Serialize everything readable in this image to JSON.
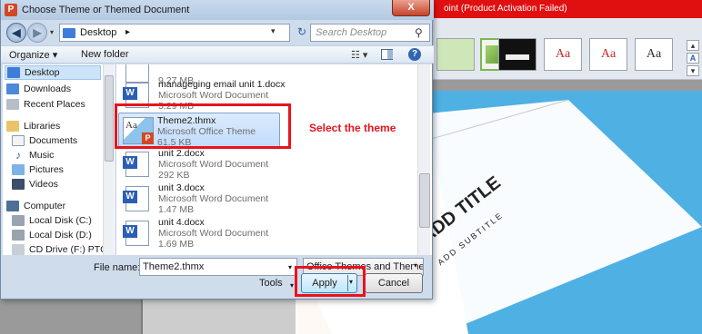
{
  "powerpoint": {
    "title_fragment": "oint (Product Activation Failed)",
    "theme_thumbs": [
      "Aa",
      "Aa",
      "Aa",
      "Aa"
    ],
    "slide_title": "ADD TITLE",
    "slide_subtitle": "ADD SUBTITLE"
  },
  "dialog": {
    "title": "Choose Theme or Themed Document",
    "app_icon": "P",
    "close_glyph": "X",
    "address": {
      "location": "Desktop",
      "chevron": "▸",
      "dropdown": "▾"
    },
    "search": {
      "placeholder": "Search Desktop",
      "icon": "search-icon"
    },
    "toolbar": {
      "organize": "Organize ▾",
      "new_folder": "New folder"
    },
    "nav_pane": {
      "favorites": [
        {
          "label": "Desktop",
          "icon": "desktop-icon"
        },
        {
          "label": "Downloads",
          "icon": "downloads-icon"
        },
        {
          "label": "Recent Places",
          "icon": "recent-places-icon"
        }
      ],
      "libraries_header": "Libraries",
      "libraries": [
        {
          "label": "Documents",
          "icon": "documents-icon"
        },
        {
          "label": "Music",
          "icon": "music-icon"
        },
        {
          "label": "Pictures",
          "icon": "pictures-icon"
        },
        {
          "label": "Videos",
          "icon": "videos-icon"
        }
      ],
      "computer_header": "Computer",
      "drives": [
        {
          "label": "Local Disk (C:)",
          "icon": "hard-disk-icon"
        },
        {
          "label": "Local Disk (D:)",
          "icon": "hard-disk-icon"
        },
        {
          "label": "CD Drive (F:) PTC",
          "icon": "cd-drive-icon"
        }
      ]
    },
    "files": [
      {
        "name": "",
        "type": "",
        "size": "9.27 MB"
      },
      {
        "name": "manageging email unit 1.docx",
        "type": "Microsoft Word Document",
        "size": "5.29 MB"
      },
      {
        "name": "Theme2.thmx",
        "type": "Microsoft Office Theme",
        "size": "61.5 KB"
      },
      {
        "name": "unit 2.docx",
        "type": "Microsoft Word Document",
        "size": "292 KB"
      },
      {
        "name": "unit 3.docx",
        "type": "Microsoft Word Document",
        "size": "1.47 MB"
      },
      {
        "name": "unit 4.docx",
        "type": "Microsoft Word Document",
        "size": "1.69 MB"
      }
    ],
    "file_name_label": "File name:",
    "file_name_value": "Theme2.thmx",
    "file_type_value": "Office Themes and Themed Do",
    "tools_label": "Tools",
    "apply_label": "Apply",
    "cancel_label": "Cancel"
  },
  "annotations": {
    "select_theme": "Select the theme",
    "color": "#e8131d"
  }
}
